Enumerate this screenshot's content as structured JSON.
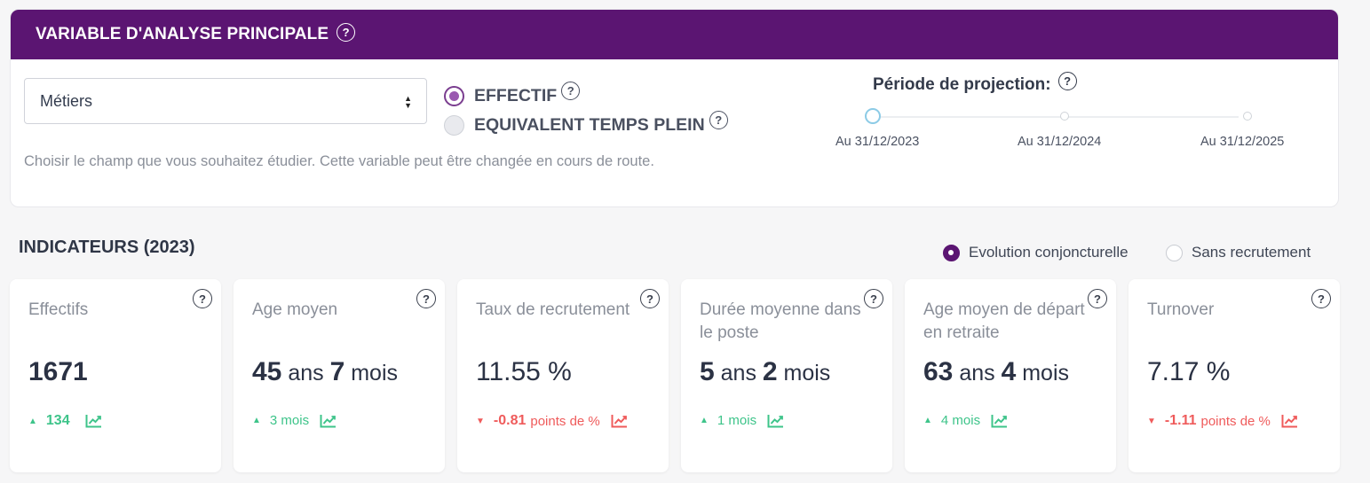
{
  "header": {
    "title": "VARIABLE D'ANALYSE PRINCIPALE",
    "help_icon": "?"
  },
  "select": {
    "value": "Métiers"
  },
  "hint": "Choisir le champ que vous souhaitez étudier. Cette variable peut être changée en cours de route.",
  "measure_options": [
    {
      "label": "EFFECTIF",
      "checked": true
    },
    {
      "label": "EQUIVALENT TEMPS PLEIN",
      "checked": false
    }
  ],
  "projection": {
    "title": "Période de projection:",
    "ticks": [
      "Au 31/12/2023",
      "Au 31/12/2024",
      "Au 31/12/2025"
    ],
    "selected_index": 0
  },
  "indicators": {
    "title": "INDICATEURS (2023)",
    "modes": [
      {
        "label": "Evolution conjoncturelle",
        "checked": true
      },
      {
        "label": "Sans recrutement",
        "checked": false
      }
    ],
    "cards": [
      {
        "label": "Effectifs",
        "value": [
          {
            "t": "1671",
            "k": "num"
          }
        ],
        "delta": {
          "dir": "up",
          "value": "134",
          "unit": ""
        }
      },
      {
        "label": "Age moyen",
        "value": [
          {
            "t": "45",
            "k": "num"
          },
          {
            "t": " ans ",
            "k": "unit"
          },
          {
            "t": "7",
            "k": "num"
          },
          {
            "t": " mois",
            "k": "unit"
          }
        ],
        "delta": {
          "dir": "up",
          "value": "",
          "unit": "3 mois"
        }
      },
      {
        "label": "Taux de recrutement",
        "value": [
          {
            "t": "11.55 %",
            "k": "plain"
          }
        ],
        "delta": {
          "dir": "down",
          "value": "-0.81",
          "unit": "points de %"
        }
      },
      {
        "label": "Durée moyenne dans le poste",
        "value": [
          {
            "t": "5",
            "k": "num"
          },
          {
            "t": " ans ",
            "k": "unit"
          },
          {
            "t": "2",
            "k": "num"
          },
          {
            "t": " mois",
            "k": "unit"
          }
        ],
        "delta": {
          "dir": "up",
          "value": "",
          "unit": "1 mois"
        }
      },
      {
        "label": "Age moyen de départ en retraite",
        "value": [
          {
            "t": "63",
            "k": "num"
          },
          {
            "t": " ans ",
            "k": "unit"
          },
          {
            "t": "4",
            "k": "num"
          },
          {
            "t": " mois",
            "k": "unit"
          }
        ],
        "delta": {
          "dir": "up",
          "value": "",
          "unit": "4 mois"
        }
      },
      {
        "label": "Turnover",
        "value": [
          {
            "t": "7.17 %",
            "k": "plain"
          }
        ],
        "delta": {
          "dir": "down",
          "value": "-1.11",
          "unit": "points de %"
        }
      }
    ]
  },
  "colors": {
    "brand": "#5b1572",
    "up": "#3ec48a",
    "down": "#ef5b5b",
    "slider_active": "#8ccbe6"
  }
}
